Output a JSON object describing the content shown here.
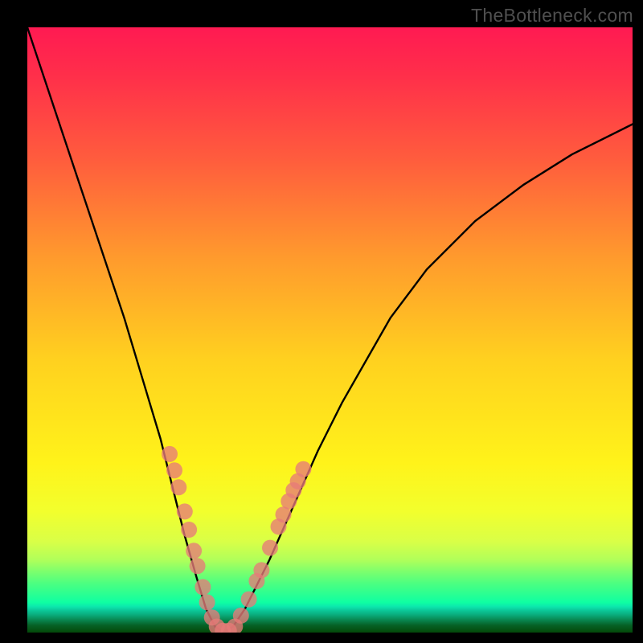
{
  "watermark": "TheBottleneck.com",
  "chart_data": {
    "type": "line",
    "title": "",
    "xlabel": "",
    "ylabel": "",
    "xlim": [
      0,
      100
    ],
    "ylim": [
      0,
      100
    ],
    "series": [
      {
        "name": "bottleneck-curve",
        "x": [
          0,
          4,
          8,
          12,
          16,
          19,
          22,
          24,
          26,
          28,
          29.5,
          31,
          32.5,
          34,
          36,
          40,
          44,
          48,
          52,
          56,
          60,
          66,
          74,
          82,
          90,
          100
        ],
        "y": [
          100,
          88,
          76,
          64,
          52,
          42,
          32,
          24,
          16,
          9,
          4,
          1,
          0,
          1,
          4,
          12,
          21,
          30,
          38,
          45,
          52,
          60,
          68,
          74,
          79,
          84
        ]
      }
    ],
    "markers": {
      "name": "highlighted-points",
      "points": [
        {
          "x": 23.5,
          "y": 29.5
        },
        {
          "x": 24.3,
          "y": 26.8
        },
        {
          "x": 25.0,
          "y": 24.0
        },
        {
          "x": 26.0,
          "y": 20.0
        },
        {
          "x": 26.7,
          "y": 17.0
        },
        {
          "x": 27.5,
          "y": 13.5
        },
        {
          "x": 28.1,
          "y": 11.0
        },
        {
          "x": 29.0,
          "y": 7.5
        },
        {
          "x": 29.7,
          "y": 5.0
        },
        {
          "x": 30.5,
          "y": 2.5
        },
        {
          "x": 31.3,
          "y": 1.0
        },
        {
          "x": 32.3,
          "y": 0.3
        },
        {
          "x": 33.3,
          "y": 0.3
        },
        {
          "x": 34.3,
          "y": 1.0
        },
        {
          "x": 35.3,
          "y": 2.8
        },
        {
          "x": 36.6,
          "y": 5.5
        },
        {
          "x": 37.9,
          "y": 8.5
        },
        {
          "x": 38.7,
          "y": 10.3
        },
        {
          "x": 40.1,
          "y": 14.0
        },
        {
          "x": 41.5,
          "y": 17.5
        },
        {
          "x": 42.3,
          "y": 19.5
        },
        {
          "x": 43.2,
          "y": 21.7
        },
        {
          "x": 44.0,
          "y": 23.5
        },
        {
          "x": 44.7,
          "y": 25.0
        },
        {
          "x": 45.6,
          "y": 27.0
        }
      ]
    }
  }
}
